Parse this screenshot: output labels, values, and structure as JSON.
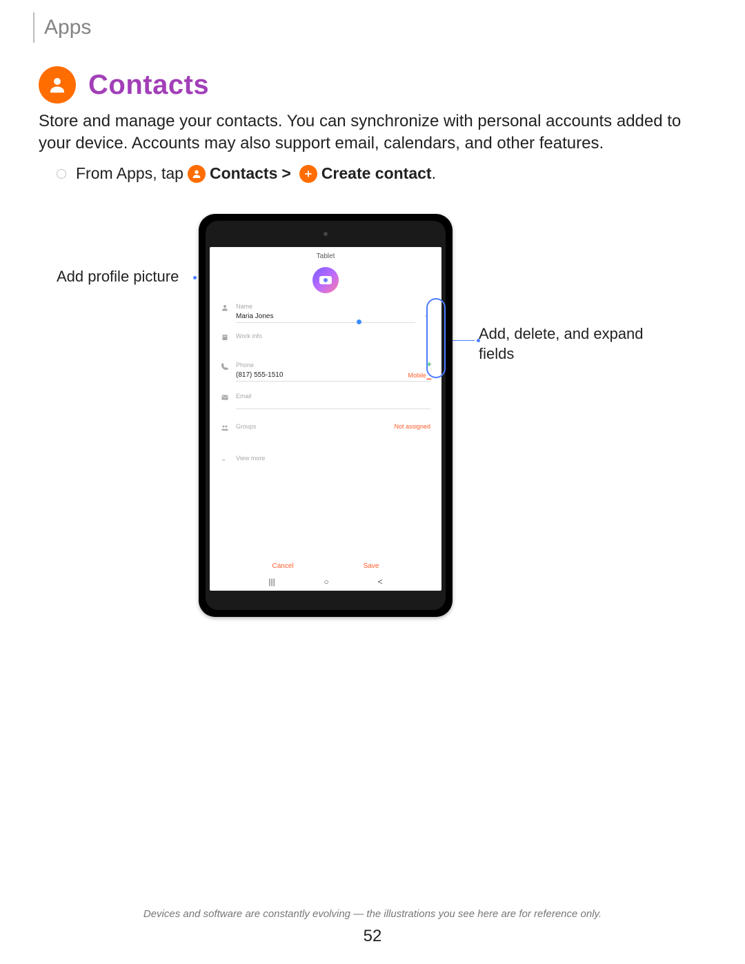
{
  "breadcrumb": "Apps",
  "title": "Contacts",
  "intro": "Store and manage your contacts. You can synchronize with personal accounts added to your device. Accounts may also support email, calendars, and other features.",
  "step": {
    "prefix": "From Apps, tap",
    "contacts_label": "Contacts",
    "caret": ">",
    "create_label": "Create contact",
    "period": "."
  },
  "callouts": {
    "left": "Add profile picture",
    "right": "Add, delete, and expand fields"
  },
  "device": {
    "header": "Tablet",
    "fields": {
      "name_label": "Name",
      "name_value": "Maria Jones",
      "work_label": "Work info",
      "phone_label": "Phone",
      "phone_value": "(817) 555-1510",
      "phone_type": "Mobile",
      "email_label": "Email",
      "groups_label": "Groups",
      "groups_value": "Not assigned",
      "view_more": "View more"
    },
    "actions": {
      "cancel": "Cancel",
      "save": "Save"
    }
  },
  "footnote": "Devices and software are constantly evolving — the illustrations you see here are for reference only.",
  "page_number": "52"
}
